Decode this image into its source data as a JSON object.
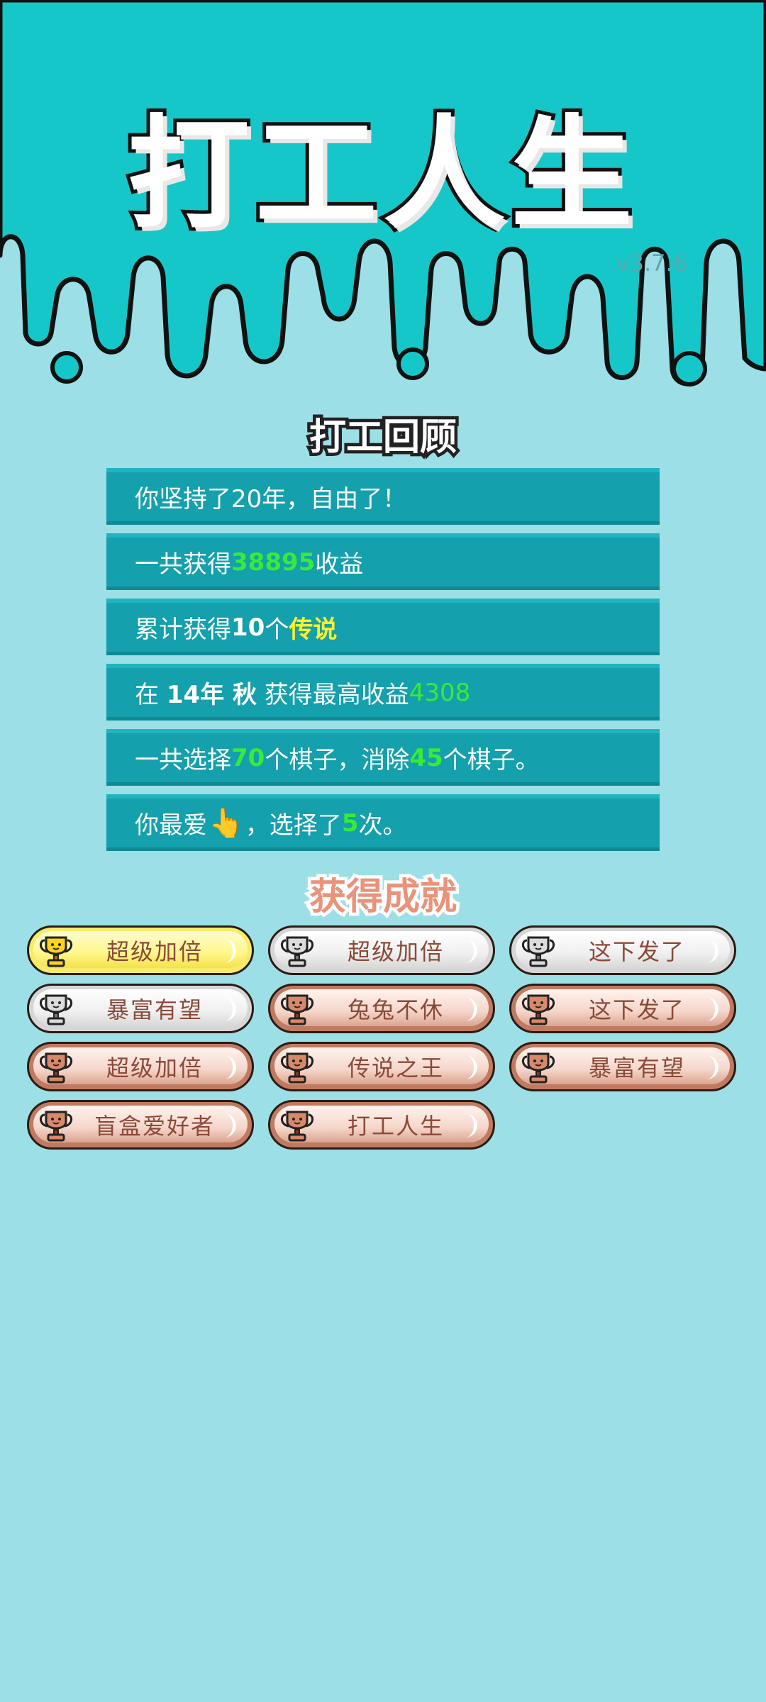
{
  "app": {
    "title": "打工人生",
    "version": "v3.7.6"
  },
  "review": {
    "title": "打工回顾",
    "rows": [
      {
        "parts": [
          {
            "text": "你坚持了20年，自由了！",
            "style": "plain"
          }
        ]
      },
      {
        "parts": [
          {
            "text": "一共获得",
            "style": "plain"
          },
          {
            "text": "38895",
            "style": "green"
          },
          {
            "text": "收益",
            "style": "plain"
          }
        ]
      },
      {
        "parts": [
          {
            "text": "累计获得",
            "style": "plain"
          },
          {
            "text": "10",
            "style": "bold"
          },
          {
            "text": "个",
            "style": "plain"
          },
          {
            "text": "传说",
            "style": "yellow"
          }
        ]
      },
      {
        "parts": [
          {
            "text": "在 ",
            "style": "plain"
          },
          {
            "text": "14年 秋",
            "style": "bold"
          },
          {
            "text": " 获得最高收益",
            "style": "plain"
          },
          {
            "text": "4308",
            "style": "green-light"
          }
        ]
      },
      {
        "parts": [
          {
            "text": "一共选择",
            "style": "plain"
          },
          {
            "text": "70",
            "style": "green"
          },
          {
            "text": "个棋子，消除",
            "style": "plain"
          },
          {
            "text": "45",
            "style": "green"
          },
          {
            "text": "个棋子。",
            "style": "plain"
          }
        ]
      },
      {
        "parts": [
          {
            "text": "你最爱",
            "style": "plain"
          },
          {
            "text": "👆",
            "style": "hand"
          },
          {
            "text": "，选择了",
            "style": "plain"
          },
          {
            "text": "5",
            "style": "green"
          },
          {
            "text": "次。",
            "style": "plain"
          }
        ]
      }
    ]
  },
  "achievements": {
    "title": "获得成就",
    "items": [
      {
        "label": "超级加倍",
        "tier": "gold"
      },
      {
        "label": "超级加倍",
        "tier": "silver"
      },
      {
        "label": "这下发了",
        "tier": "silver"
      },
      {
        "label": "暴富有望",
        "tier": "silver"
      },
      {
        "label": "兔兔不休",
        "tier": "bronze"
      },
      {
        "label": "这下发了",
        "tier": "bronze"
      },
      {
        "label": "超级加倍",
        "tier": "bronze"
      },
      {
        "label": "传说之王",
        "tier": "bronze"
      },
      {
        "label": "暴富有望",
        "tier": "bronze"
      },
      {
        "label": "盲盒爱好者",
        "tier": "bronze"
      },
      {
        "label": "打工人生",
        "tier": "bronze"
      }
    ]
  },
  "colors": {
    "header_teal": "#16c7c9",
    "background": "#9ddfe6",
    "row_bg": "#14a0ac",
    "highlight_green": "#36ec36",
    "highlight_yellow": "#fff02a",
    "gold": "#f6ec6a",
    "silver": "#d6d6d6",
    "bronze": "#c07a62"
  }
}
